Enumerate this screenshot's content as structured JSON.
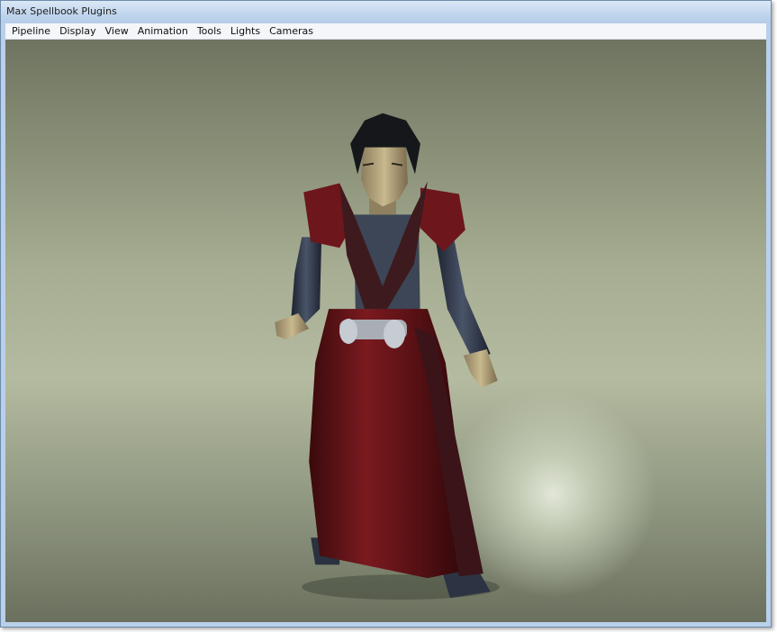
{
  "window": {
    "title": "Max Spellbook Plugins"
  },
  "menu": {
    "items": [
      {
        "label": "Pipeline"
      },
      {
        "label": "Display"
      },
      {
        "label": "View"
      },
      {
        "label": "Animation"
      },
      {
        "label": "Tools"
      },
      {
        "label": "Lights"
      },
      {
        "label": "Cameras"
      }
    ]
  },
  "viewport": {
    "content": "3d-character-model"
  }
}
